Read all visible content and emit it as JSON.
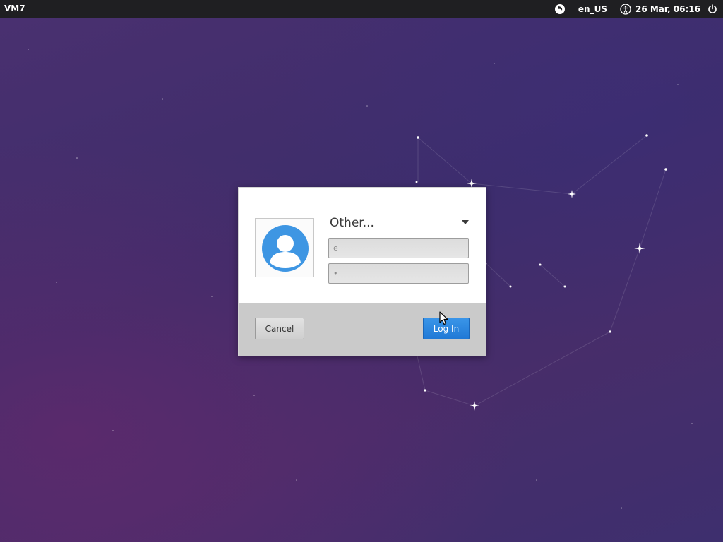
{
  "top_panel": {
    "host_name": "VM7",
    "language": "en_US",
    "clock": "26 Mar, 06:16",
    "icons": [
      "session-icon",
      "accessibility-icon",
      "power-icon"
    ]
  },
  "login": {
    "user_label": "Other...",
    "username_value": "e",
    "password_value": "•",
    "cancel_label": "Cancel",
    "login_label": "Log In",
    "accent_color": "#2a84e0"
  },
  "colors": {
    "panel": "#1f1f22",
    "background": "#452e6c"
  }
}
